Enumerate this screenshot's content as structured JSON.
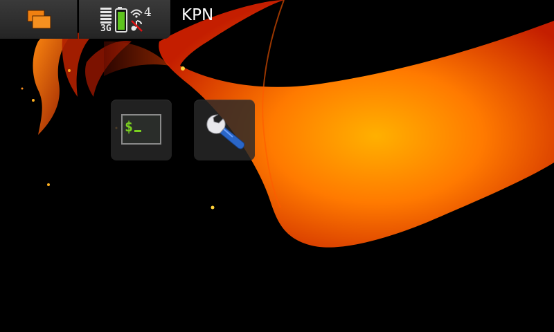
{
  "statusbar": {
    "operator": "KPN",
    "network_type": "3G",
    "wifi_count": "4",
    "icons": [
      "task-switcher-icon",
      "signal-strength-icon",
      "battery-icon",
      "wifi-icon",
      "music-muted-icon"
    ],
    "battery_color": "#5ec41e"
  },
  "desktop": {
    "shortcuts": [
      {
        "icon": "terminal-icon"
      },
      {
        "icon": "wrench-icon"
      }
    ]
  },
  "colors": {
    "flame_orange": "#ff6a00",
    "flame_yellow": "#ffb000",
    "bar_bg": "#2e2e2e"
  }
}
